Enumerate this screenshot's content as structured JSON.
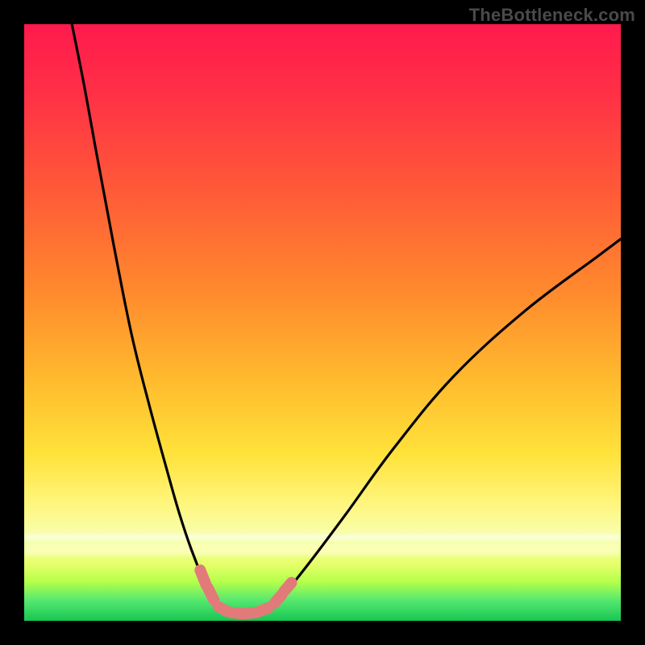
{
  "watermark": {
    "text": "TheBottleneck.com"
  },
  "colors": {
    "black": "#000000",
    "red_top": "#ff1a4d",
    "red_mid": "#ff4a3a",
    "orange": "#ff8b2b",
    "yellow": "#ffe23a",
    "pale_yellow": "#fff7a0",
    "lemon": "#f4ff5c",
    "lime": "#b4ff4a",
    "green": "#1fe05e",
    "curve_stroke": "#000000",
    "marker_fill": "#e27a7a",
    "marker_stroke": "#c94f4f"
  },
  "geometry": {
    "stage": 800,
    "margin": 30,
    "plot": 740
  },
  "gradient_stops": [
    {
      "offset": 0.0,
      "color": "#ff1a4d"
    },
    {
      "offset": 0.12,
      "color": "#ff3146"
    },
    {
      "offset": 0.28,
      "color": "#ff5a38"
    },
    {
      "offset": 0.45,
      "color": "#ff8a2d"
    },
    {
      "offset": 0.6,
      "color": "#ffbc2e"
    },
    {
      "offset": 0.72,
      "color": "#ffe23a"
    },
    {
      "offset": 0.8,
      "color": "#fff57a"
    },
    {
      "offset": 0.86,
      "color": "#f7ffb0"
    },
    {
      "offset": 0.905,
      "color": "#e6ff6a"
    },
    {
      "offset": 0.935,
      "color": "#b4ff4a"
    },
    {
      "offset": 0.965,
      "color": "#57e86f"
    },
    {
      "offset": 1.0,
      "color": "#16c653"
    }
  ],
  "glow_bands": [
    {
      "top_frac": 0.855,
      "height_frac": 0.01,
      "color": "rgba(255,255,255,0.55)"
    },
    {
      "top_frac": 0.87,
      "height_frac": 0.02,
      "color": "rgba(255,255,200,0.65)"
    }
  ],
  "chart_data": {
    "type": "line",
    "title": "",
    "xlabel": "",
    "ylabel": "",
    "xlim": [
      0,
      100
    ],
    "ylim": [
      0,
      100
    ],
    "legend": false,
    "grid": false,
    "series": [
      {
        "name": "left-branch",
        "x": [
          8,
          10,
          12,
          15,
          18,
          21,
          24,
          26,
          28,
          30,
          31.5,
          32.5
        ],
        "y": [
          100,
          90,
          79,
          63,
          48,
          36,
          25,
          18,
          12,
          7,
          4,
          2.5
        ]
      },
      {
        "name": "valley-floor",
        "x": [
          32.5,
          34,
          36,
          38,
          40,
          41.5
        ],
        "y": [
          2.5,
          1.5,
          1.2,
          1.2,
          1.5,
          2.5
        ]
      },
      {
        "name": "right-branch",
        "x": [
          41.5,
          44,
          48,
          54,
          62,
          72,
          84,
          96,
          100
        ],
        "y": [
          2.5,
          5,
          10,
          18,
          29,
          41,
          52,
          61,
          64
        ]
      }
    ],
    "markers": {
      "name": "highlight-segments",
      "description": "thick salmon dashes near the valley bottom on both sides and across the floor",
      "color": "#e27a7a",
      "segments": [
        {
          "x": [
            29.5,
            30.5
          ],
          "y": [
            8.5,
            6.0
          ]
        },
        {
          "x": [
            30.8,
            31.8
          ],
          "y": [
            5.5,
            3.5
          ]
        },
        {
          "x": [
            32.5,
            34.0
          ],
          "y": [
            2.4,
            1.6
          ]
        },
        {
          "x": [
            34.5,
            36.5
          ],
          "y": [
            1.4,
            1.2
          ]
        },
        {
          "x": [
            37.0,
            39.0
          ],
          "y": [
            1.2,
            1.4
          ]
        },
        {
          "x": [
            39.5,
            41.0
          ],
          "y": [
            1.6,
            2.2
          ]
        },
        {
          "x": [
            42.0,
            43.2
          ],
          "y": [
            3.0,
            4.4
          ]
        },
        {
          "x": [
            43.6,
            44.8
          ],
          "y": [
            5.0,
            6.4
          ]
        }
      ]
    }
  }
}
